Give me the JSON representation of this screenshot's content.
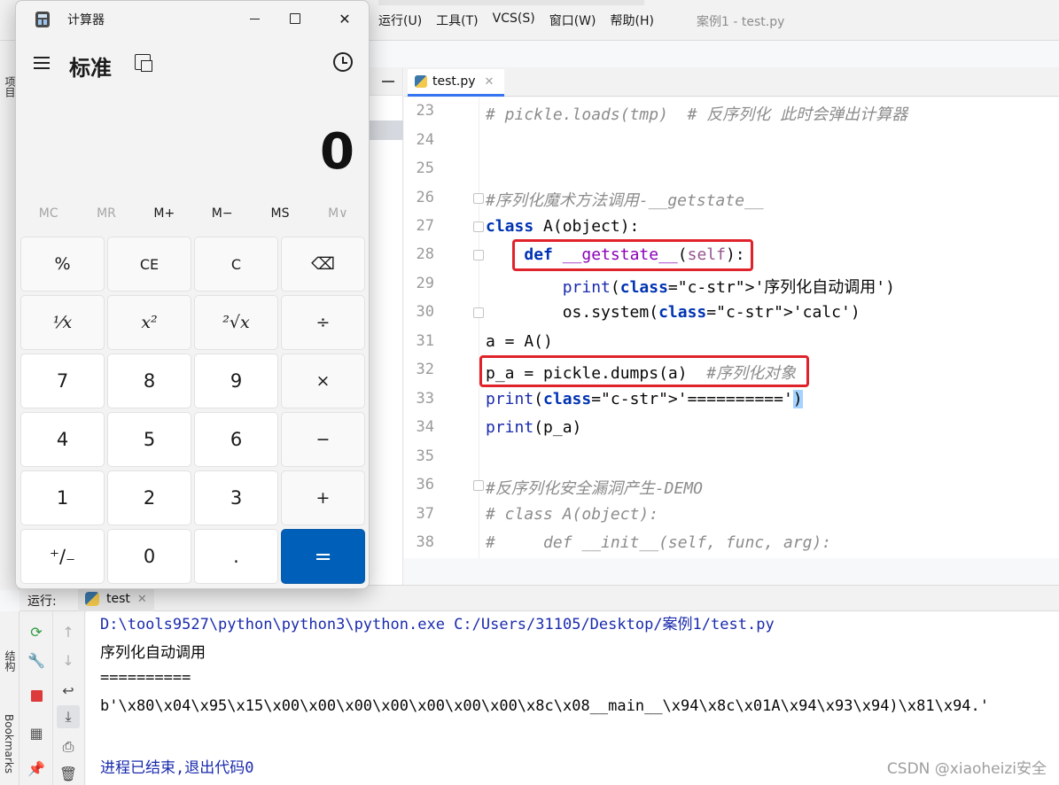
{
  "ide": {
    "menus": [
      "运行(U)",
      "工具(T)",
      "VCS(S)",
      "窗口(W)",
      "帮助(H)"
    ],
    "window_title": "案例1 - test.py",
    "left_strip_label": "项目",
    "editor_tab": "test.py",
    "code_lines": [
      {
        "n": "23",
        "text": "# pickle.loads(tmp)  # 反序列化 此时会弹出计算器"
      },
      {
        "n": "24",
        "text": ""
      },
      {
        "n": "25",
        "text": ""
      },
      {
        "n": "26",
        "text": "#序列化魔术方法调用-__getstate__"
      },
      {
        "n": "27",
        "text": "class A(object):"
      },
      {
        "n": "28",
        "text": "    def __getstate__(self):"
      },
      {
        "n": "29",
        "text": "        print('序列化自动调用')"
      },
      {
        "n": "30",
        "text": "        os.system('calc')"
      },
      {
        "n": "31",
        "text": "a = A()"
      },
      {
        "n": "32",
        "text": "p_a = pickle.dumps(a)  #序列化对象"
      },
      {
        "n": "33",
        "text": "print('==========')"
      },
      {
        "n": "34",
        "text": "print(p_a)"
      },
      {
        "n": "35",
        "text": ""
      },
      {
        "n": "36",
        "text": "#反序列化安全漏洞产生-DEMO"
      },
      {
        "n": "37",
        "text": "# class A(object):"
      },
      {
        "n": "38",
        "text": "#     def __init__(self, func, arg):"
      }
    ],
    "colors": {
      "highlight_box": "#e0232b",
      "keyword": "#0033b3",
      "string": "#067d17"
    }
  },
  "run": {
    "label": "运行:",
    "tab": "test",
    "side_labels": [
      "结构",
      "Bookmarks"
    ],
    "output": [
      "D:\\tools9527\\python\\python3\\python.exe C:/Users/31105/Desktop/案例1/test.py",
      "序列化自动调用",
      "==========",
      "b'\\x80\\x04\\x95\\x15\\x00\\x00\\x00\\x00\\x00\\x00\\x00\\x8c\\x08__main__\\x94\\x8c\\x01A\\x94\\x93\\x94)\\x81\\x94.'",
      "",
      "进程已结束,退出代码0"
    ],
    "watermark": "CSDN @xiaoheizi安全"
  },
  "calculator": {
    "title": "计算器",
    "mode": "标准",
    "display": "0",
    "memory": [
      "MC",
      "MR",
      "M+",
      "M−",
      "MS",
      "M∨"
    ],
    "keys": [
      "%",
      "CE",
      "C",
      "⌫",
      "⅟x",
      "x²",
      "²√x",
      "÷",
      "7",
      "8",
      "9",
      "×",
      "4",
      "5",
      "6",
      "−",
      "1",
      "2",
      "3",
      "+",
      "⁺∕₋",
      "0",
      ".",
      "="
    ],
    "accent": "#005fb8"
  }
}
